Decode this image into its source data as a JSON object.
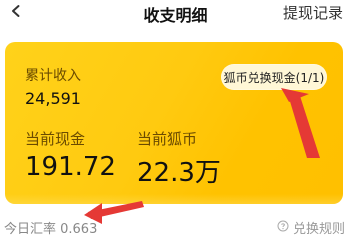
{
  "nav": {
    "title": "收支明细",
    "action_label": "提现记录"
  },
  "card": {
    "income_label": "累计收入",
    "income_value": "24,591",
    "cash_label": "当前现金",
    "cash_value": "191.72",
    "coin_label": "当前狐币",
    "coin_value": "22.3万",
    "convert_button_label": "狐币兑换现金(1/1)"
  },
  "footer": {
    "rate_label": "今日汇率 0.663",
    "rules_label": "兑换规则"
  },
  "colors": {
    "accent_yellow": "#ffc000",
    "annotation_red": "#e53935"
  },
  "icons": {
    "back": "chevron-left-icon",
    "help": "question-circle-icon"
  }
}
